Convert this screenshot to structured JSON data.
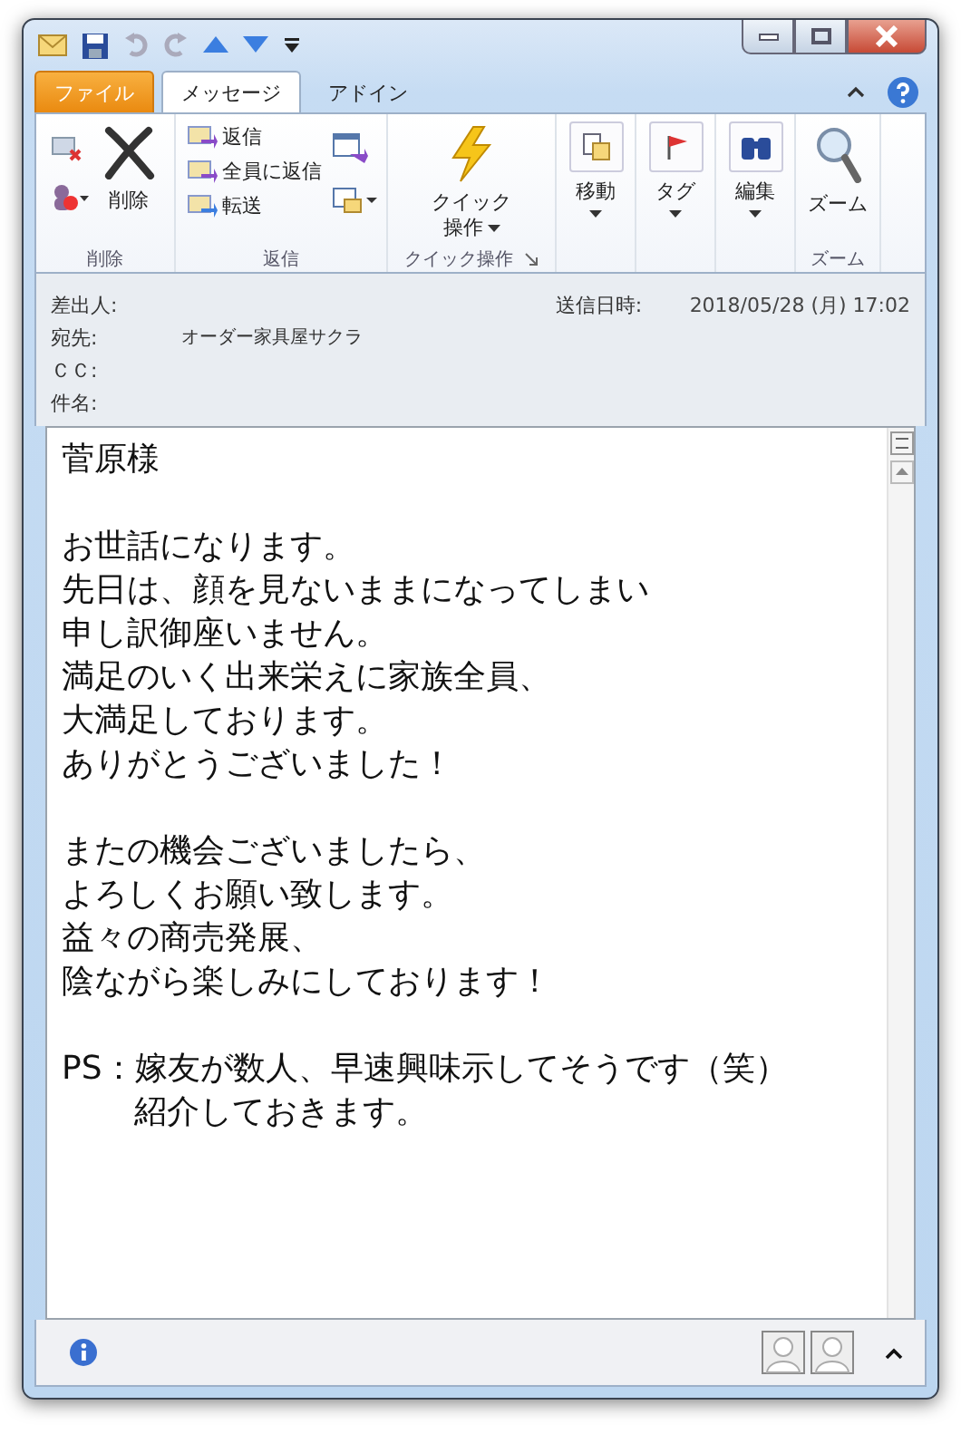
{
  "tabs": [
    {
      "label": "ファイル",
      "kind": "file",
      "selected": false
    },
    {
      "label": "メッセージ",
      "kind": "tab",
      "selected": true
    },
    {
      "label": "アドイン",
      "kind": "tab",
      "selected": false
    }
  ],
  "ribbon": {
    "groups": [
      {
        "label": "削除",
        "buttons": [
          "削除"
        ]
      },
      {
        "label": "返信",
        "buttons": [
          "返信",
          "全員に返信",
          "転送"
        ]
      },
      {
        "label": "クイック操作",
        "button_lines": [
          "クイック",
          "操作"
        ]
      },
      {
        "buttons": [
          "移動"
        ]
      },
      {
        "buttons": [
          "タグ"
        ]
      },
      {
        "buttons": [
          "編集"
        ]
      },
      {
        "label": "ズーム",
        "buttons": [
          "ズーム"
        ]
      }
    ]
  },
  "header": {
    "fields": [
      {
        "label": "差出人:"
      },
      {
        "label": "宛先:",
        "value": "オーダー家具屋サクラ"
      },
      {
        "label": "ＣＣ:"
      },
      {
        "label": "件名:"
      }
    ],
    "sent": {
      "label": "送信日時:",
      "value": "2018/05/28 (月) 17:02"
    }
  },
  "body": [
    {
      "lines": [
        {
          "text": "菅原様",
          "indent": false
        }
      ]
    },
    {
      "lines": [
        {
          "text": "お世話になります。",
          "indent": false
        },
        {
          "text": "先日は、顔を見ないままになってしまい",
          "indent": false
        },
        {
          "text": "申し訳御座いません。",
          "indent": false
        },
        {
          "text": "満足のいく出来栄えに家族全員、",
          "indent": false
        },
        {
          "text": "大満足しております。",
          "indent": false
        },
        {
          "text": "ありがとうございました！",
          "indent": false
        }
      ]
    },
    {
      "lines": [
        {
          "text": "またの機会ございましたら、",
          "indent": false
        },
        {
          "text": "よろしくお願い致します。",
          "indent": false
        },
        {
          "text": "益々の商売発展、",
          "indent": false
        },
        {
          "text": "陰ながら楽しみにしております！",
          "indent": false
        }
      ]
    },
    {
      "lines": [
        {
          "text": "PS：嫁友が数人、早速興味示してそうです（笑）",
          "indent": false
        },
        {
          "text": "紹介しておきます。",
          "indent": true
        }
      ]
    }
  ]
}
